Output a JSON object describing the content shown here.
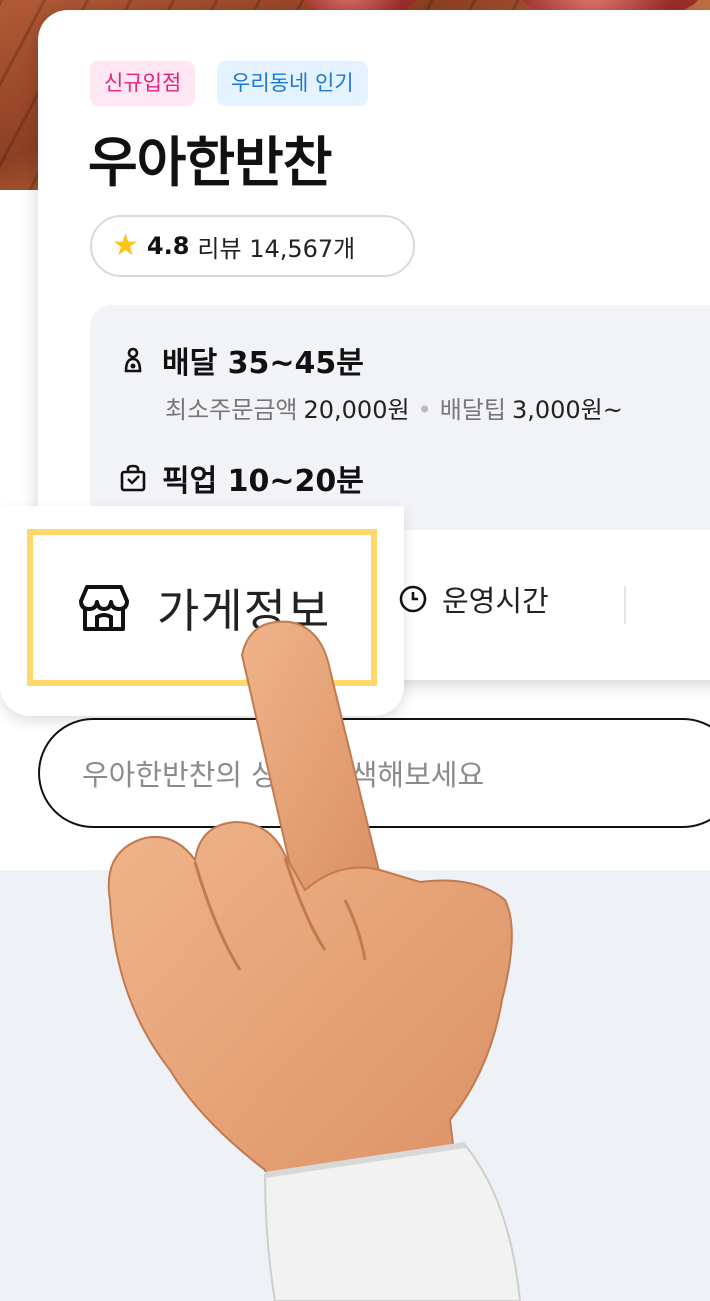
{
  "badges": {
    "new": "신규입점",
    "popular": "우리동네 인기"
  },
  "store": {
    "name": "우아한반찬"
  },
  "rating": {
    "star_icon": "star-icon",
    "score": "4.8",
    "reviews": "리뷰 14,567개"
  },
  "delivery": {
    "title": "배달 35~45분",
    "min_order_label": "최소주문금액",
    "min_order_value": "20,000원",
    "tip_label": "배달팁",
    "tip_value": "3,000원~"
  },
  "pickup": {
    "title": "픽업 10~20분"
  },
  "tabs": {
    "store_info": "가게정보",
    "hours": "운영시간"
  },
  "search": {
    "placeholder": "우아한반찬의 상품을 검색해보세요",
    "visible_text": "우아한반찬의 상     검색해보세요"
  },
  "colors": {
    "highlight": "#ffd86b",
    "badge_new": "#e6227f",
    "badge_popular": "#1a77d6",
    "star": "#ffc21a"
  }
}
